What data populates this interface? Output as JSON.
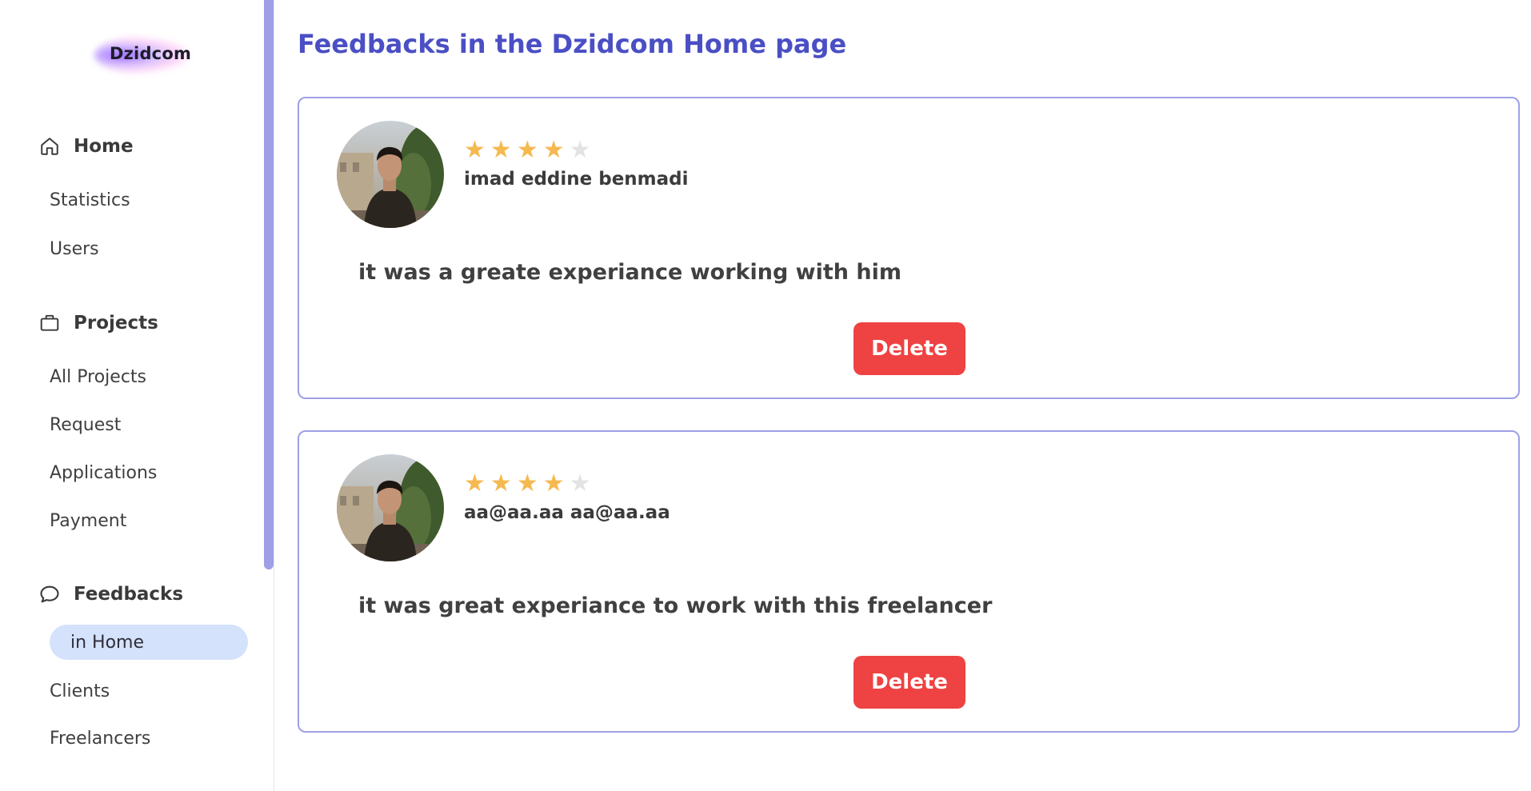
{
  "app": {
    "logo_text": "Dzidcom"
  },
  "sidebar": {
    "sections": [
      {
        "label": "Home",
        "icon": "home-icon",
        "items": [
          "Statistics",
          "Users"
        ]
      },
      {
        "label": "Projects",
        "icon": "briefcase-icon",
        "items": [
          "All Projects",
          "Request",
          "Applications",
          "Payment"
        ]
      },
      {
        "label": "Feedbacks",
        "icon": "chat-bubble-icon",
        "items": [
          "in Home",
          "Clients",
          "Freelancers"
        ]
      }
    ],
    "active_item": "in Home"
  },
  "main": {
    "title": "Feedbacks in the Dzidcom Home page",
    "feedbacks": [
      {
        "reviewer": "imad eddine benmadi",
        "rating": 4,
        "max_rating": 5,
        "comment": "it was a greate experiance working with him",
        "delete_label": "Delete"
      },
      {
        "reviewer": "aa@aa.aa aa@aa.aa",
        "rating": 4,
        "max_rating": 5,
        "comment": "it was great experiance to work with this freelancer",
        "delete_label": "Delete"
      }
    ]
  },
  "colors": {
    "accent": "#4a4fc4",
    "card_border": "#9e9fe6",
    "star": "#f5b94f",
    "delete": "#ef4242",
    "active_item_bg": "#d4e2fb"
  }
}
